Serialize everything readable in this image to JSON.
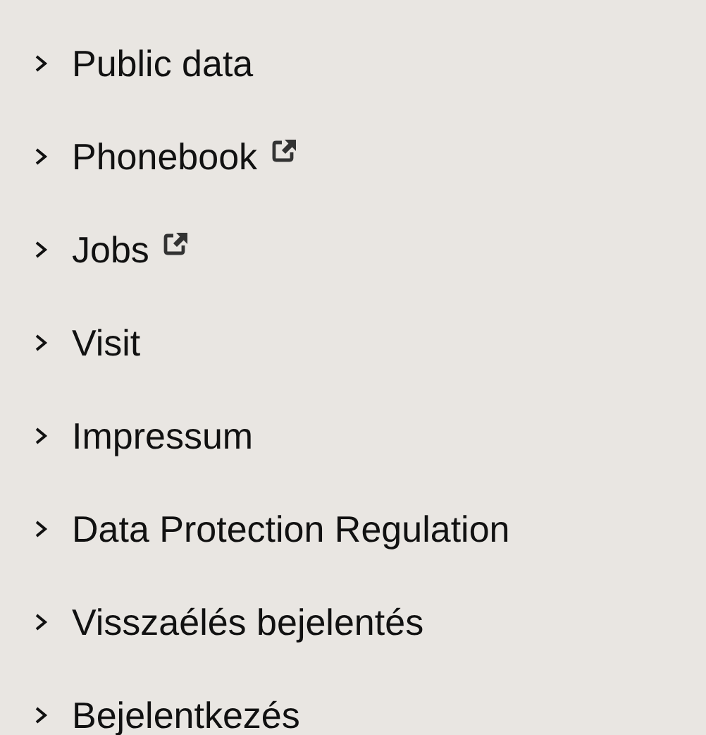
{
  "links": [
    {
      "label": "Public data",
      "external": false
    },
    {
      "label": "Phonebook",
      "external": true
    },
    {
      "label": "Jobs",
      "external": true
    },
    {
      "label": "Visit",
      "external": false
    },
    {
      "label": "Impressum",
      "external": false
    },
    {
      "label": "Data Protection Regulation",
      "external": false
    },
    {
      "label": "Visszaélés bejelentés",
      "external": false
    },
    {
      "label": "Bejelentkezés",
      "external": false
    }
  ]
}
